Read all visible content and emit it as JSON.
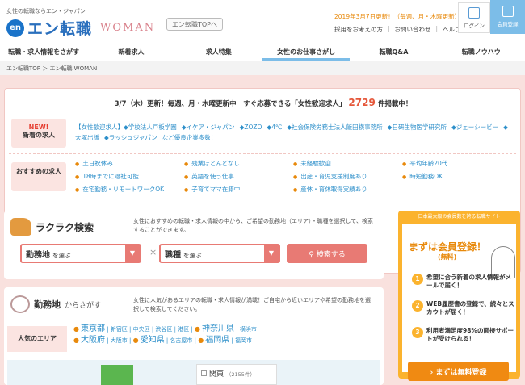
{
  "header": {
    "tagline": "女性の転職ならエン・ジャパン",
    "logo_en": "en",
    "logo_text": "エン転職",
    "logo_sub": "WOMAN",
    "top_link": "エン転職TOPへ",
    "update_notice": "2019年3月7日更新！（毎週、月・木曜更新）",
    "links": [
      "採用をお考えの方",
      "お問い合わせ",
      "ヘルプ"
    ],
    "login_label": "ログイン",
    "register_label": "会員登録"
  },
  "nav": {
    "items": [
      "転職・求人情報をさがす",
      "新着求人",
      "求人特集",
      "女性のお仕事さがし",
      "転職Q&A",
      "転職ノウハウ"
    ],
    "active_index": 3
  },
  "breadcrumb": "エン転職TOP ＞ エン転職 WOMAN",
  "summary": {
    "prefix": "3/7（木）更新！毎週、月・木曜更新中　すぐ応募できる「女性歓迎求人」",
    "count": "2729",
    "suffix": "件掲載中！"
  },
  "new_jobs": {
    "label_new": "NEW!",
    "label": "新着の求人",
    "links": [
      "【女性歓迎求人】◆学校法人戸板学園",
      "◆イケア・ジャパン",
      "◆ZOZO",
      "◆4℃",
      "◆社会保険労務士法人飯田横事務所",
      "◆日研生物医学研究所",
      "◆ジェーシービー",
      "◆大塚出版",
      "◆ラッシュジャパン",
      "など優良企業多数！"
    ]
  },
  "recommended": {
    "label": "おすすめの求人",
    "items": [
      "土日祝休み",
      "残業ほとんどなし",
      "未経験歓迎",
      "平均年齢20代",
      "18時までに退社可能",
      "英語を使う仕事",
      "出産・育児支援制度あり",
      "時短勤務OK",
      "在宅勤務・リモートワークOK",
      "子育てママ在籍中",
      "産休・育休取得実績あり"
    ]
  },
  "quick_search": {
    "title": "ラクラク検索",
    "description": "女性におすすめの転職・求人情報の中から、ご希望の勤務地（エリア）・職種を選択して、検索することができます。",
    "area_label": "勤務地",
    "area_hint": "を選ぶ",
    "job_label": "職種",
    "job_hint": "を選ぶ",
    "times": "×",
    "search_button": "検索する"
  },
  "area_search": {
    "title": "勤務地",
    "title_suffix": "からさがす",
    "description": "女性に人気があるエリアの転職・求人情報が満載！ご自宅から近いエリアや希望の勤務地を選択して検索してください。",
    "popular_label": "人気のエリア",
    "line1": [
      "東京都",
      "新宿区",
      "中央区",
      "渋谷区",
      "港区",
      "神奈川県",
      "横浜市"
    ],
    "line2": [
      "大阪府",
      "大阪市",
      "愛知県",
      "名古屋市",
      "福岡県",
      "福岡市"
    ],
    "region": "関東",
    "region_count": "（2155件）"
  },
  "register_box": {
    "header": "日本最大級の会員数を誇る転職サイト",
    "title": "まずは会員登録！",
    "free": "(無料)",
    "points": [
      "希望に合う新着の求人情報がメールで届く！",
      "WEB履歴書の登録で、続々とスカウトが届く！",
      "利用者満足度98%の面接サポートが受けられる！"
    ],
    "button": "› まずは無料登録"
  },
  "colors": {
    "accent": "#e87a74",
    "blue": "#2d8fca",
    "orange": "#fbb32e",
    "pink_bg": "#f9e1de"
  }
}
